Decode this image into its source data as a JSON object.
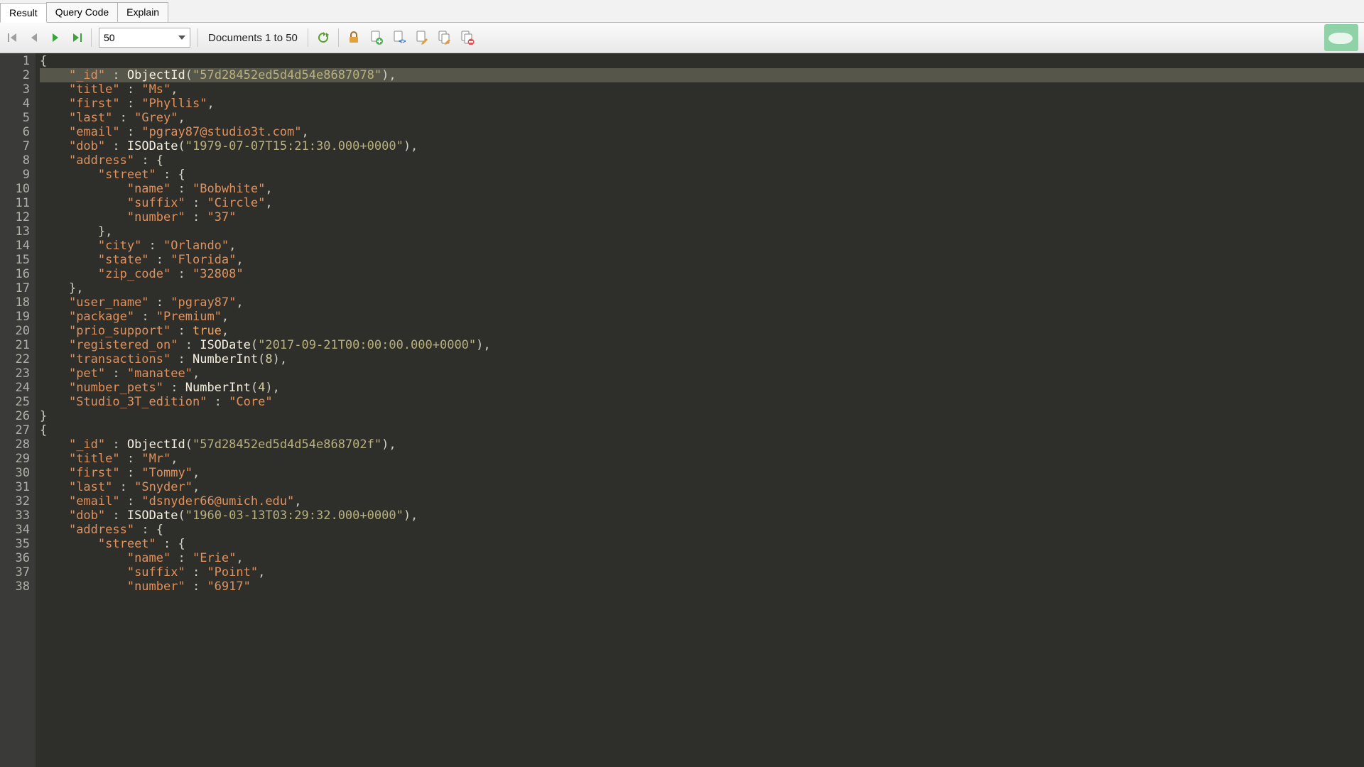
{
  "tabs": {
    "result": "Result",
    "query_code": "Query Code",
    "explain": "Explain",
    "active": "result"
  },
  "toolbar": {
    "page_size": "50",
    "documents_label": "Documents 1 to 50",
    "icons": {
      "first": "first-page-icon",
      "prev": "prev-page-icon",
      "next": "next-page-icon",
      "last": "last-page-icon",
      "refresh": "refresh-icon",
      "extra": [
        "lock-icon",
        "doc-add-icon",
        "doc-diff-icon",
        "doc-edit-icon",
        "doc-copy-icon",
        "doc-delete-icon"
      ]
    }
  },
  "highlighted_line": 2,
  "code_lines": [
    {
      "n": 1,
      "t": [
        [
          "p",
          "{"
        ]
      ]
    },
    {
      "n": 2,
      "t": [
        [
          "sp",
          "    "
        ],
        [
          "k",
          "\"_id\""
        ],
        [
          "p",
          " : "
        ],
        [
          "fn",
          "ObjectId"
        ],
        [
          "p",
          "("
        ],
        [
          "in",
          "\"57d28452ed5d4d54e8687078\""
        ],
        [
          "p",
          "),"
        ]
      ]
    },
    {
      "n": 3,
      "t": [
        [
          "sp",
          "    "
        ],
        [
          "k",
          "\"title\""
        ],
        [
          "p",
          " : "
        ],
        [
          "k",
          "\"Ms\""
        ],
        [
          "p",
          ","
        ]
      ]
    },
    {
      "n": 4,
      "t": [
        [
          "sp",
          "    "
        ],
        [
          "k",
          "\"first\""
        ],
        [
          "p",
          " : "
        ],
        [
          "k",
          "\"Phyllis\""
        ],
        [
          "p",
          ","
        ]
      ]
    },
    {
      "n": 5,
      "t": [
        [
          "sp",
          "    "
        ],
        [
          "k",
          "\"last\""
        ],
        [
          "p",
          " : "
        ],
        [
          "k",
          "\"Grey\""
        ],
        [
          "p",
          ","
        ]
      ]
    },
    {
      "n": 6,
      "t": [
        [
          "sp",
          "    "
        ],
        [
          "k",
          "\"email\""
        ],
        [
          "p",
          " : "
        ],
        [
          "k",
          "\"pgray87@studio3t.com\""
        ],
        [
          "p",
          ","
        ]
      ]
    },
    {
      "n": 7,
      "t": [
        [
          "sp",
          "    "
        ],
        [
          "k",
          "\"dob\""
        ],
        [
          "p",
          " : "
        ],
        [
          "fn",
          "ISODate"
        ],
        [
          "p",
          "("
        ],
        [
          "in",
          "\"1979-07-07T15:21:30.000+0000\""
        ],
        [
          "p",
          "),"
        ]
      ]
    },
    {
      "n": 8,
      "t": [
        [
          "sp",
          "    "
        ],
        [
          "k",
          "\"address\""
        ],
        [
          "p",
          " : {"
        ]
      ]
    },
    {
      "n": 9,
      "t": [
        [
          "sp",
          "        "
        ],
        [
          "k",
          "\"street\""
        ],
        [
          "p",
          " : {"
        ]
      ]
    },
    {
      "n": 10,
      "t": [
        [
          "sp",
          "            "
        ],
        [
          "k",
          "\"name\""
        ],
        [
          "p",
          " : "
        ],
        [
          "k",
          "\"Bobwhite\""
        ],
        [
          "p",
          ","
        ]
      ]
    },
    {
      "n": 11,
      "t": [
        [
          "sp",
          "            "
        ],
        [
          "k",
          "\"suffix\""
        ],
        [
          "p",
          " : "
        ],
        [
          "k",
          "\"Circle\""
        ],
        [
          "p",
          ","
        ]
      ]
    },
    {
      "n": 12,
      "t": [
        [
          "sp",
          "            "
        ],
        [
          "k",
          "\"number\""
        ],
        [
          "p",
          " : "
        ],
        [
          "k",
          "\"37\""
        ]
      ]
    },
    {
      "n": 13,
      "t": [
        [
          "sp",
          "        "
        ],
        [
          "p",
          "},"
        ]
      ]
    },
    {
      "n": 14,
      "t": [
        [
          "sp",
          "        "
        ],
        [
          "k",
          "\"city\""
        ],
        [
          "p",
          " : "
        ],
        [
          "k",
          "\"Orlando\""
        ],
        [
          "p",
          ","
        ]
      ]
    },
    {
      "n": 15,
      "t": [
        [
          "sp",
          "        "
        ],
        [
          "k",
          "\"state\""
        ],
        [
          "p",
          " : "
        ],
        [
          "k",
          "\"Florida\""
        ],
        [
          "p",
          ","
        ]
      ]
    },
    {
      "n": 16,
      "t": [
        [
          "sp",
          "        "
        ],
        [
          "k",
          "\"zip_code\""
        ],
        [
          "p",
          " : "
        ],
        [
          "k",
          "\"32808\""
        ]
      ]
    },
    {
      "n": 17,
      "t": [
        [
          "sp",
          "    "
        ],
        [
          "p",
          "},"
        ]
      ]
    },
    {
      "n": 18,
      "t": [
        [
          "sp",
          "    "
        ],
        [
          "k",
          "\"user_name\""
        ],
        [
          "p",
          " : "
        ],
        [
          "k",
          "\"pgray87\""
        ],
        [
          "p",
          ","
        ]
      ]
    },
    {
      "n": 19,
      "t": [
        [
          "sp",
          "    "
        ],
        [
          "k",
          "\"package\""
        ],
        [
          "p",
          " : "
        ],
        [
          "k",
          "\"Premium\""
        ],
        [
          "p",
          ","
        ]
      ]
    },
    {
      "n": 20,
      "t": [
        [
          "sp",
          "    "
        ],
        [
          "k",
          "\"prio_support\""
        ],
        [
          "p",
          " : "
        ],
        [
          "c",
          "true"
        ],
        [
          "p",
          ","
        ]
      ]
    },
    {
      "n": 21,
      "t": [
        [
          "sp",
          "    "
        ],
        [
          "k",
          "\"registered_on\""
        ],
        [
          "p",
          " : "
        ],
        [
          "fn",
          "ISODate"
        ],
        [
          "p",
          "("
        ],
        [
          "in",
          "\"2017-09-21T00:00:00.000+0000\""
        ],
        [
          "p",
          "),"
        ]
      ]
    },
    {
      "n": 22,
      "t": [
        [
          "sp",
          "    "
        ],
        [
          "k",
          "\"transactions\""
        ],
        [
          "p",
          " : "
        ],
        [
          "fn",
          "NumberInt"
        ],
        [
          "p",
          "("
        ],
        [
          "n",
          "8"
        ],
        [
          "p",
          "),"
        ]
      ]
    },
    {
      "n": 23,
      "t": [
        [
          "sp",
          "    "
        ],
        [
          "k",
          "\"pet\""
        ],
        [
          "p",
          " : "
        ],
        [
          "k",
          "\"manatee\""
        ],
        [
          "p",
          ","
        ]
      ]
    },
    {
      "n": 24,
      "t": [
        [
          "sp",
          "    "
        ],
        [
          "k",
          "\"number_pets\""
        ],
        [
          "p",
          " : "
        ],
        [
          "fn",
          "NumberInt"
        ],
        [
          "p",
          "("
        ],
        [
          "n",
          "4"
        ],
        [
          "p",
          "),"
        ]
      ]
    },
    {
      "n": 25,
      "t": [
        [
          "sp",
          "    "
        ],
        [
          "k",
          "\"Studio_3T_edition\""
        ],
        [
          "p",
          " : "
        ],
        [
          "k",
          "\"Core\""
        ]
      ]
    },
    {
      "n": 26,
      "t": [
        [
          "p",
          "}"
        ]
      ]
    },
    {
      "n": 27,
      "t": [
        [
          "p",
          "{"
        ]
      ]
    },
    {
      "n": 28,
      "t": [
        [
          "sp",
          "    "
        ],
        [
          "k",
          "\"_id\""
        ],
        [
          "p",
          " : "
        ],
        [
          "fn",
          "ObjectId"
        ],
        [
          "p",
          "("
        ],
        [
          "in",
          "\"57d28452ed5d4d54e868702f\""
        ],
        [
          "p",
          "),"
        ]
      ]
    },
    {
      "n": 29,
      "t": [
        [
          "sp",
          "    "
        ],
        [
          "k",
          "\"title\""
        ],
        [
          "p",
          " : "
        ],
        [
          "k",
          "\"Mr\""
        ],
        [
          "p",
          ","
        ]
      ]
    },
    {
      "n": 30,
      "t": [
        [
          "sp",
          "    "
        ],
        [
          "k",
          "\"first\""
        ],
        [
          "p",
          " : "
        ],
        [
          "k",
          "\"Tommy\""
        ],
        [
          "p",
          ","
        ]
      ]
    },
    {
      "n": 31,
      "t": [
        [
          "sp",
          "    "
        ],
        [
          "k",
          "\"last\""
        ],
        [
          "p",
          " : "
        ],
        [
          "k",
          "\"Snyder\""
        ],
        [
          "p",
          ","
        ]
      ]
    },
    {
      "n": 32,
      "t": [
        [
          "sp",
          "    "
        ],
        [
          "k",
          "\"email\""
        ],
        [
          "p",
          " : "
        ],
        [
          "k",
          "\"dsnyder66@umich.edu\""
        ],
        [
          "p",
          ","
        ]
      ]
    },
    {
      "n": 33,
      "t": [
        [
          "sp",
          "    "
        ],
        [
          "k",
          "\"dob\""
        ],
        [
          "p",
          " : "
        ],
        [
          "fn",
          "ISODate"
        ],
        [
          "p",
          "("
        ],
        [
          "in",
          "\"1960-03-13T03:29:32.000+0000\""
        ],
        [
          "p",
          "),"
        ]
      ]
    },
    {
      "n": 34,
      "t": [
        [
          "sp",
          "    "
        ],
        [
          "k",
          "\"address\""
        ],
        [
          "p",
          " : {"
        ]
      ]
    },
    {
      "n": 35,
      "t": [
        [
          "sp",
          "        "
        ],
        [
          "k",
          "\"street\""
        ],
        [
          "p",
          " : {"
        ]
      ]
    },
    {
      "n": 36,
      "t": [
        [
          "sp",
          "            "
        ],
        [
          "k",
          "\"name\""
        ],
        [
          "p",
          " : "
        ],
        [
          "k",
          "\"Erie\""
        ],
        [
          "p",
          ","
        ]
      ]
    },
    {
      "n": 37,
      "t": [
        [
          "sp",
          "            "
        ],
        [
          "k",
          "\"suffix\""
        ],
        [
          "p",
          " : "
        ],
        [
          "k",
          "\"Point\""
        ],
        [
          "p",
          ","
        ]
      ]
    },
    {
      "n": 38,
      "t": [
        [
          "sp",
          "            "
        ],
        [
          "k",
          "\"number\""
        ],
        [
          "p",
          " : "
        ],
        [
          "k",
          "\"6917\""
        ]
      ]
    }
  ]
}
